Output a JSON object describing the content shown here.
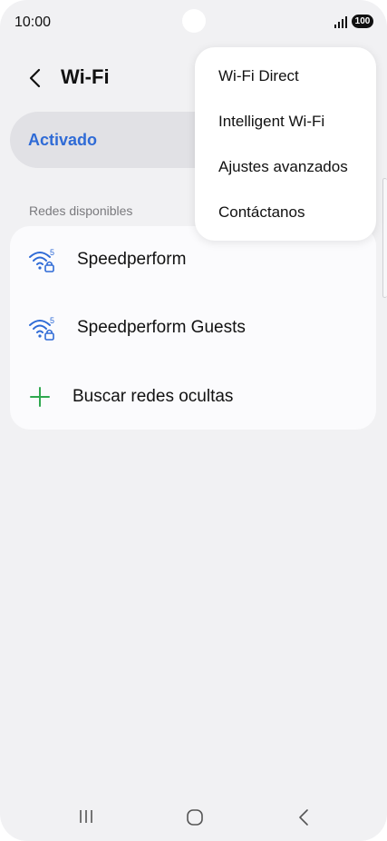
{
  "status_bar": {
    "time": "10:00",
    "battery": "100",
    "icons": [
      "signal-icon",
      "battery-icon"
    ]
  },
  "header": {
    "title": "Wi-Fi",
    "back_icon": "chevron-left-icon"
  },
  "wifi_toggle": {
    "label": "Activado"
  },
  "networks": {
    "section_label": "Redes disponibles",
    "items": [
      {
        "name": "Speedperform",
        "icon": "wifi-5ghz-locked-icon"
      },
      {
        "name": "Speedperform Guests",
        "icon": "wifi-5ghz-locked-icon"
      }
    ],
    "hidden_networks_label": "Buscar redes ocultas"
  },
  "popup_menu": {
    "items": [
      "Wi-Fi Direct",
      "Intelligent Wi-Fi",
      "Ajustes avanzados",
      "Contáctanos"
    ]
  },
  "nav_bar": {
    "icons": [
      "recent-apps-icon",
      "home-icon",
      "back-icon"
    ]
  },
  "colors": {
    "accent": "#2f6bd6",
    "background": "#f1f1f3",
    "card": "#fbfbfd",
    "toggle_row": "#e1e1e5",
    "add_green": "#2fa84f"
  }
}
